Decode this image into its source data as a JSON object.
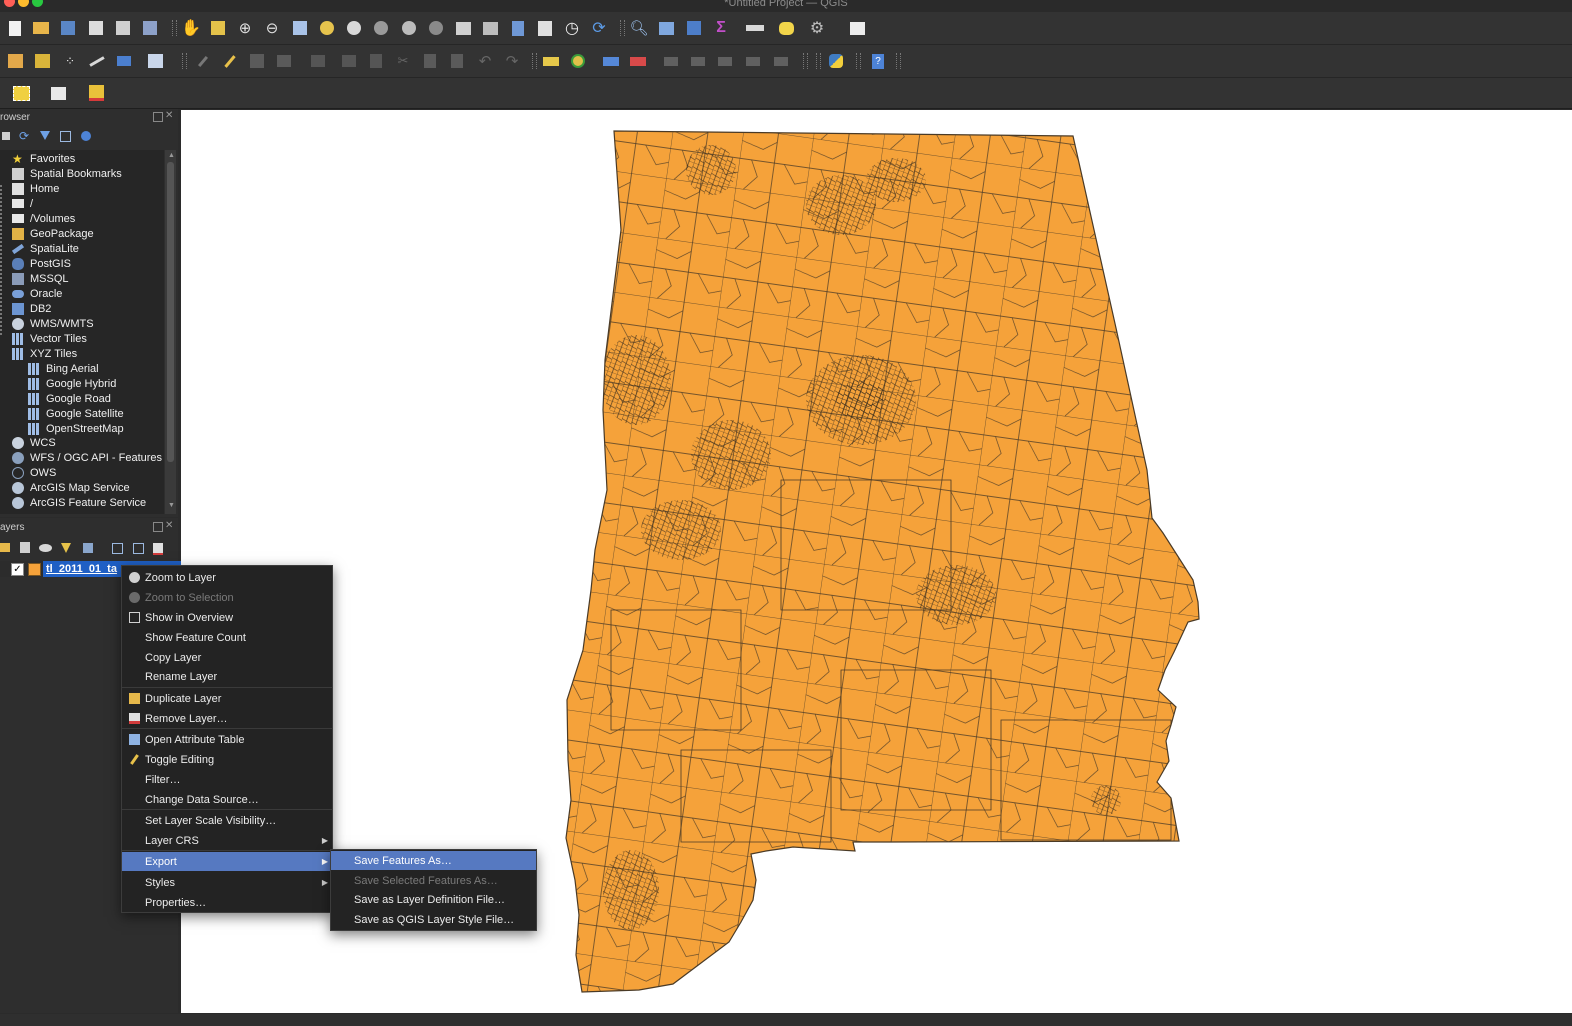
{
  "window": {
    "title": "*Untitled Project — QGIS"
  },
  "colors": {
    "map_fill": "#f5a23a",
    "map_stroke": "#4a3a26",
    "menu_selected": "#5679c1",
    "canvas_bg": "#ffffff"
  },
  "browser_panel": {
    "title": "rowser",
    "items": [
      {
        "label": "Favorites",
        "icon": "star-icon"
      },
      {
        "label": "Spatial Bookmarks",
        "icon": "bookmark-icon"
      },
      {
        "label": "Home",
        "icon": "home-folder-icon"
      },
      {
        "label": "/",
        "icon": "folder-icon"
      },
      {
        "label": "/Volumes",
        "icon": "folder-icon"
      },
      {
        "label": "GeoPackage",
        "icon": "geopackage-icon"
      },
      {
        "label": "SpatiaLite",
        "icon": "spatialite-icon"
      },
      {
        "label": "PostGIS",
        "icon": "postgis-icon"
      },
      {
        "label": "MSSQL",
        "icon": "mssql-icon"
      },
      {
        "label": "Oracle",
        "icon": "oracle-icon"
      },
      {
        "label": "DB2",
        "icon": "db2-icon"
      },
      {
        "label": "WMS/WMTS",
        "icon": "globe-icon"
      },
      {
        "label": "Vector Tiles",
        "icon": "grid-icon"
      },
      {
        "label": "XYZ Tiles",
        "icon": "grid-icon"
      },
      {
        "label": "Bing Aerial",
        "icon": "grid-icon"
      },
      {
        "label": "Google Hybrid",
        "icon": "grid-icon"
      },
      {
        "label": "Google Road",
        "icon": "grid-icon"
      },
      {
        "label": "Google Satellite",
        "icon": "grid-icon"
      },
      {
        "label": "OpenStreetMap",
        "icon": "grid-icon"
      },
      {
        "label": "WCS",
        "icon": "globe-icon"
      },
      {
        "label": "WFS / OGC API - Features",
        "icon": "globe-icon"
      },
      {
        "label": "OWS",
        "icon": "globe-icon"
      },
      {
        "label": "ArcGIS Map Service",
        "icon": "arcgis-icon"
      },
      {
        "label": "ArcGIS Feature Service",
        "icon": "arcgis-icon"
      }
    ]
  },
  "layers_panel": {
    "title": "ayers",
    "layer_name": "tl_2011_01_ta"
  },
  "context_menu": {
    "items": [
      {
        "label": "Zoom to Layer",
        "icon": "zoom-layer-icon",
        "enabled": true
      },
      {
        "label": "Zoom to Selection",
        "icon": "zoom-selection-icon",
        "enabled": false
      },
      {
        "label": "Show in Overview",
        "icon": "overview-icon",
        "enabled": true
      },
      {
        "label": "Show Feature Count",
        "icon": "",
        "enabled": true
      },
      {
        "label": "Copy Layer",
        "icon": "",
        "enabled": true
      },
      {
        "label": "Rename Layer",
        "icon": "",
        "enabled": true
      },
      {
        "label": "Duplicate Layer",
        "icon": "duplicate-icon",
        "enabled": true
      },
      {
        "label": "Remove Layer…",
        "icon": "remove-layer-icon",
        "enabled": true
      },
      {
        "label": "Open Attribute Table",
        "icon": "table-icon",
        "enabled": true
      },
      {
        "label": "Toggle Editing",
        "icon": "pencil-icon",
        "enabled": true
      },
      {
        "label": "Filter…",
        "icon": "",
        "enabled": true
      },
      {
        "label": "Change Data Source…",
        "icon": "",
        "enabled": true
      },
      {
        "label": "Set Layer Scale Visibility…",
        "icon": "",
        "enabled": true
      },
      {
        "label": "Layer CRS",
        "icon": "",
        "enabled": true,
        "submenu": true
      },
      {
        "label": "Export",
        "icon": "",
        "enabled": true,
        "submenu": true,
        "selected": true
      },
      {
        "label": "Styles",
        "icon": "",
        "enabled": true,
        "submenu": true
      },
      {
        "label": "Properties…",
        "icon": "",
        "enabled": true
      }
    ]
  },
  "export_submenu": {
    "items": [
      {
        "label": "Save Features As…",
        "enabled": true,
        "selected": true
      },
      {
        "label": "Save Selected Features As…",
        "enabled": false
      },
      {
        "label": "Save as Layer Definition File…",
        "enabled": true
      },
      {
        "label": "Save as QGIS Layer Style File…",
        "enabled": true
      }
    ]
  }
}
